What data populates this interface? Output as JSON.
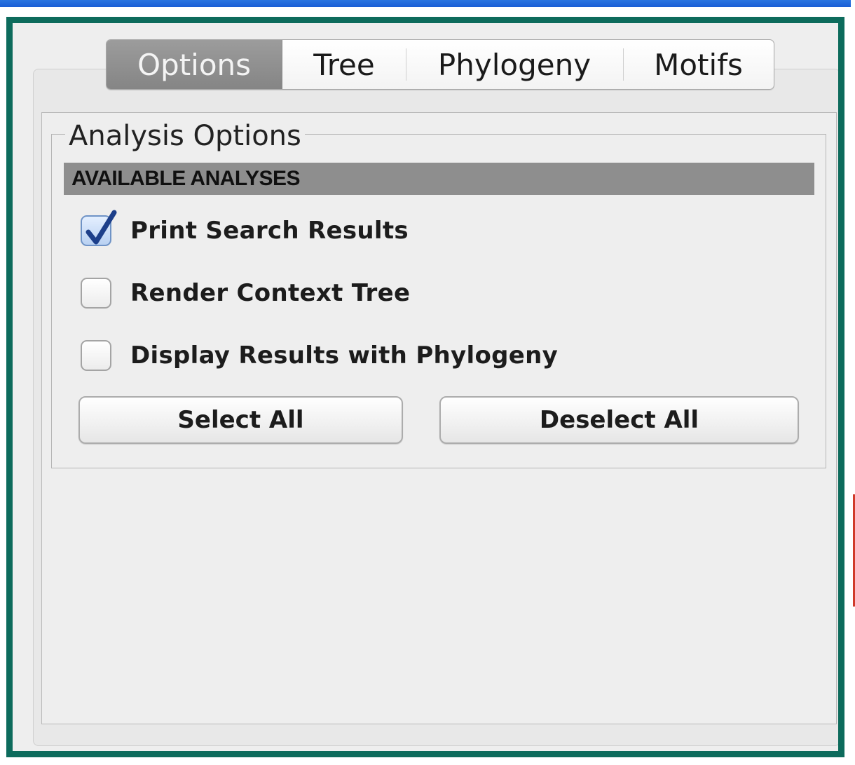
{
  "window": {
    "frame_color": "#0d6b5c",
    "titlebar_color": "#1a5fd6"
  },
  "tabs": [
    {
      "label": "Options",
      "selected": true
    },
    {
      "label": "Tree",
      "selected": false
    },
    {
      "label": "Phylogeny",
      "selected": false
    },
    {
      "label": "Motifs",
      "selected": false
    }
  ],
  "analysis": {
    "group_title": "Analysis Options",
    "header": "AVAILABLE ANALYSES",
    "options": [
      {
        "label": "Print Search Results",
        "checked": true
      },
      {
        "label": "Render Context Tree",
        "checked": false
      },
      {
        "label": "Display Results with Phylogeny",
        "checked": false
      }
    ],
    "select_all_label": "Select All",
    "deselect_all_label": "Deselect All"
  },
  "icons": {
    "checkmark": "checkmark-icon"
  }
}
